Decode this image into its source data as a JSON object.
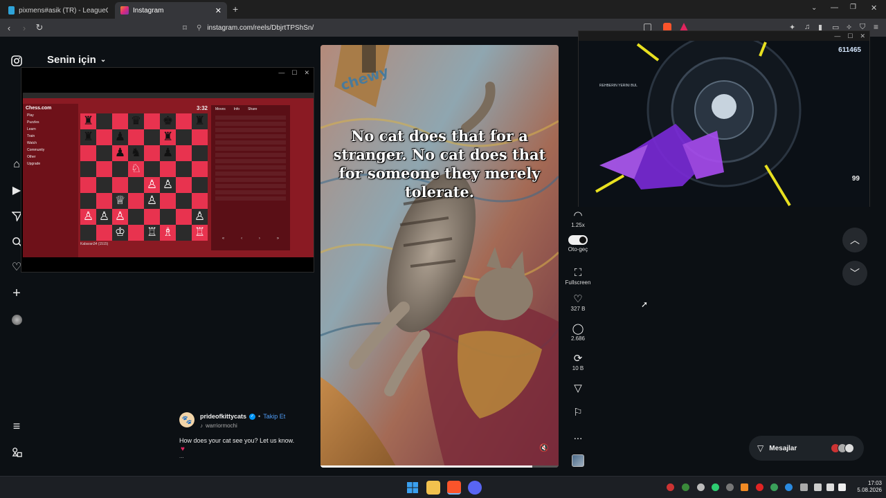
{
  "browser": {
    "tabs": [
      {
        "title": "pixmens#asik (TR) - LeagueOfGraphs",
        "favicon_color": "#2ea3d8"
      },
      {
        "title": "Instagram",
        "favicon_color": "#e1306c"
      }
    ],
    "new_tab_label": "+",
    "url": "instagram.com/reels/DbjrtTPShSn/"
  },
  "feed": {
    "title": "Senin için",
    "caption_overlay": "No cat does that for a stranger. No cat does that for someone they merely tolerate.",
    "box_brand": "chewy"
  },
  "post": {
    "username": "prideofkittycats",
    "follow_label": "Takip Et",
    "audio": "warriormochi",
    "caption": "How does your cat see you? Let us know.",
    "heart_emoji": "♥",
    "more_label": "..."
  },
  "rail": {
    "speed": "1.25x",
    "autoplay_label": "Oto-geç",
    "fullscreen_label": "Fullscreen",
    "likes": "327 B",
    "comments": "2.686",
    "reposts": "10 B",
    "more_label": "..."
  },
  "messages": {
    "label": "Mesajlar"
  },
  "game_overlay": {
    "score": "611465",
    "ammo": "99",
    "side_text": "REHBERIN YERINI BUL"
  },
  "chess": {
    "timer": "3:32",
    "site_name": "Chess.com",
    "sidebar_items": [
      "Play",
      "Puzzles",
      "Learn",
      "Train",
      "Watch",
      "Community",
      "Other",
      "Upgrade"
    ],
    "move_tabs": [
      "Moves",
      "Info",
      "Share"
    ],
    "player_bottom": "Kabaran34 (1515)"
  },
  "taskbar": {
    "time": "17:03",
    "date": "5.08.2026"
  },
  "colors": {
    "accent": "#0095f6",
    "bg": "#0c1014",
    "board_light": "#e8334f",
    "board_dark": "#2b2b2b"
  }
}
